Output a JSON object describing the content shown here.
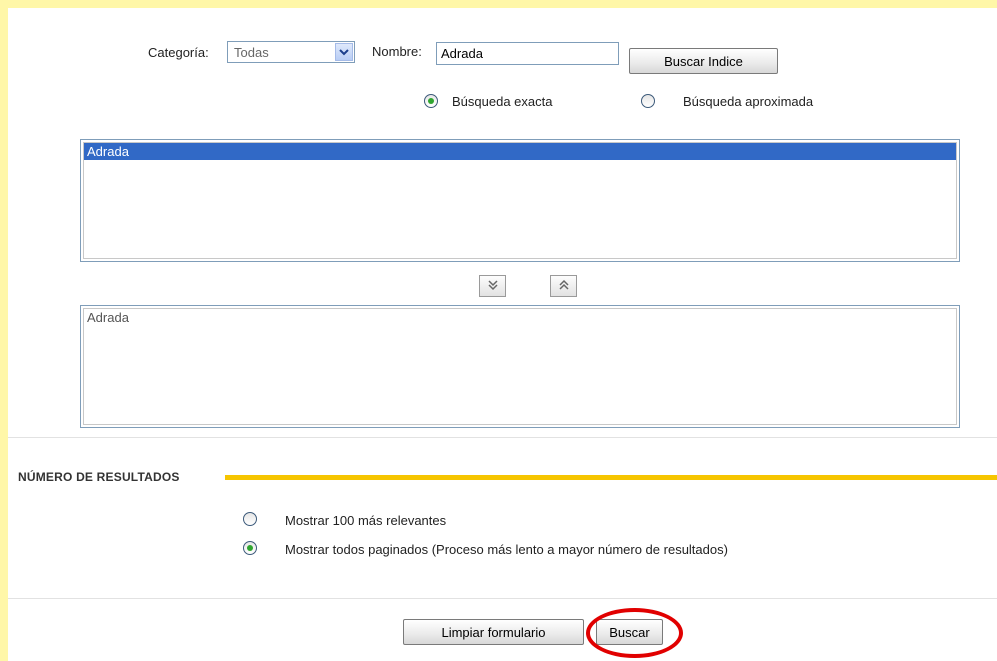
{
  "search": {
    "category_label": "Categoría:",
    "category_selected": "Todas",
    "name_label": "Nombre:",
    "name_value": "Adrada",
    "search_index_button": "Buscar Indice",
    "exact_label": "Búsqueda exacta",
    "approx_label": "Búsqueda aproximada",
    "mode_selected": "exact"
  },
  "index_list": {
    "items": [
      "Adrada"
    ],
    "selected": "Adrada"
  },
  "move": {
    "down_icon": "double-chevron-down-icon",
    "up_icon": "double-chevron-up-icon"
  },
  "selected_list": {
    "items": [
      "Adrada"
    ]
  },
  "results": {
    "section_title": "NÚMERO DE RESULTADOS",
    "option_top100": "Mostrar 100 más relevantes",
    "option_all_paged": "Mostrar todos paginados (Proceso más lento a mayor número de resultados)",
    "selected": "all_paged"
  },
  "actions": {
    "clear_label": "Limpiar formulario",
    "search_label": "Buscar"
  },
  "colors": {
    "frame": "#fff7a8",
    "section_accent": "#f6c500",
    "selection": "#3169c6",
    "radio_dot": "#2fa52f",
    "annotation_ring": "#e10000"
  }
}
